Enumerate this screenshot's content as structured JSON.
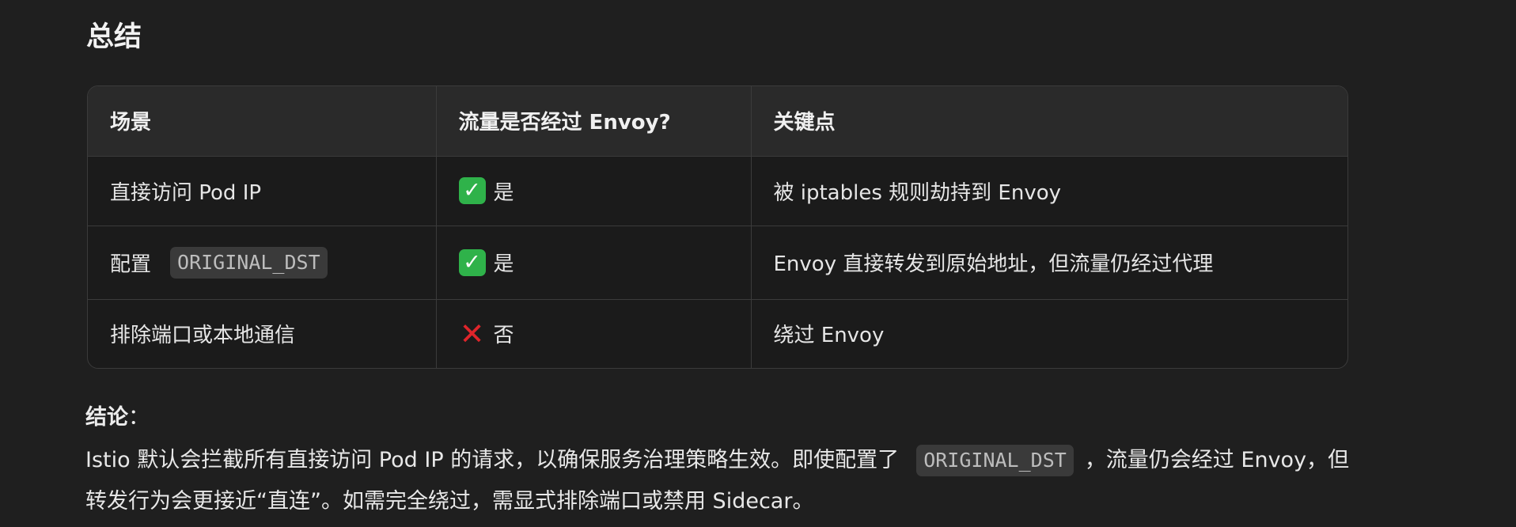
{
  "heading": "总结",
  "table": {
    "headers": [
      "场景",
      "流量是否经过 Envoy?",
      "关键点"
    ],
    "rows": [
      {
        "scenario": "直接访问 Pod IP",
        "icon": "check-icon",
        "through": "是",
        "key_point": "被 iptables 规则劫持到 Envoy"
      },
      {
        "scenario": "配置",
        "scenario_code": "ORIGINAL_DST",
        "icon": "check-icon",
        "through": "是",
        "key_point": "Envoy 直接转发到原始地址，但流量仍经过代理"
      },
      {
        "scenario": "排除端口或本地通信",
        "icon": "cross-icon",
        "through": "否",
        "key_point": "绕过 Envoy"
      }
    ]
  },
  "conclusion": {
    "title": "结论",
    "colon": "：",
    "text_before": "Istio 默认会拦截所有直接访问 Pod IP 的请求，以确保服务治理策略生效。即使配置了",
    "code": "ORIGINAL_DST",
    "text_after": "，流量仍会经过 Envoy，但转发行为会更接近“直连”。如需完全绕过，需显式排除端口或禁用 Sidecar。"
  },
  "icons": {
    "check": "✓",
    "cross": "✕"
  },
  "colors": {
    "background": "#1f1f1f",
    "check_green": "#2fb24a",
    "cross_red": "#e0252b"
  }
}
